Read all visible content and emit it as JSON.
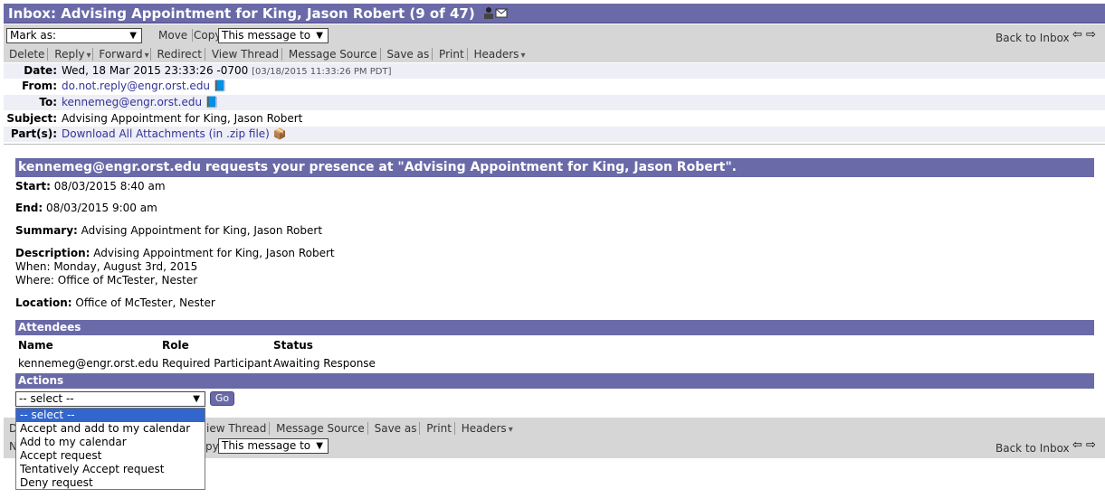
{
  "title": {
    "text": "Inbox: Advising Appointment for King, Jason Robert (9 of 47)"
  },
  "toolbar_top": {
    "mark_as": "Mark as:",
    "move": "Move",
    "copy": "Copy",
    "target": "This message to",
    "back": "Back to Inbox"
  },
  "actions_bar": {
    "delete": "Delete",
    "reply": "Reply",
    "forward": "Forward",
    "redirect": "Redirect",
    "view_thread": "View Thread",
    "message_source": "Message Source",
    "save_as": "Save as",
    "print": "Print",
    "headers": "Headers"
  },
  "headers": {
    "date_label": "Date:",
    "date_value": "Wed, 18 Mar 2015 23:33:26 -0700",
    "date_local": "[03/18/2015 11:33:26 PM PDT]",
    "from_label": "From:",
    "from_value": "do.not.reply@engr.orst.edu",
    "to_label": "To:",
    "to_value": "kennemeg@engr.orst.edu",
    "subject_label": "Subject:",
    "subject_value": "Advising Appointment for King, Jason Robert",
    "parts_label": "Part(s):",
    "parts_value": "Download All Attachments (in .zip file)"
  },
  "invite": {
    "heading": "kennemeg@engr.orst.edu requests your presence at \"Advising Appointment for King, Jason Robert\".",
    "start_label": "Start:",
    "start_value": "08/03/2015 8:40 am",
    "end_label": "End:",
    "end_value": "08/03/2015 9:00 am",
    "summary_label": "Summary:",
    "summary_value": "Advising Appointment for King, Jason Robert",
    "description_label": "Description:",
    "description_value": "Advising Appointment for King, Jason Robert",
    "when": "When: Monday, August 3rd, 2015",
    "where": "Where: Office of McTester, Nester",
    "location_label": "Location:",
    "location_value": "Office of McTester, Nester"
  },
  "attendees": {
    "title": "Attendees",
    "col_name": "Name",
    "col_role": "Role",
    "col_status": "Status",
    "row_name": "kennemeg@engr.orst.edu",
    "row_role": "Required Participant",
    "row_status": "Awaiting Response"
  },
  "actions": {
    "title": "Actions",
    "selected": "-- select --",
    "go": "Go",
    "options": [
      "-- select --",
      "Accept and add to my calendar",
      "Add to my calendar",
      "Accept request",
      "Tentatively Accept request",
      "Deny request"
    ]
  },
  "bottom_bar": {
    "d": "D",
    "view_thread": "iew Thread",
    "message_source": "Message Source",
    "save_as": "Save as",
    "print": "Print",
    "headers": "Headers",
    "m": "N",
    "copy": "py",
    "target": "This message to",
    "back": "Back to Inbox"
  },
  "colors": {
    "accent": "#6a6aa8",
    "toolbar": "#d6d6d6",
    "link": "#333399"
  }
}
